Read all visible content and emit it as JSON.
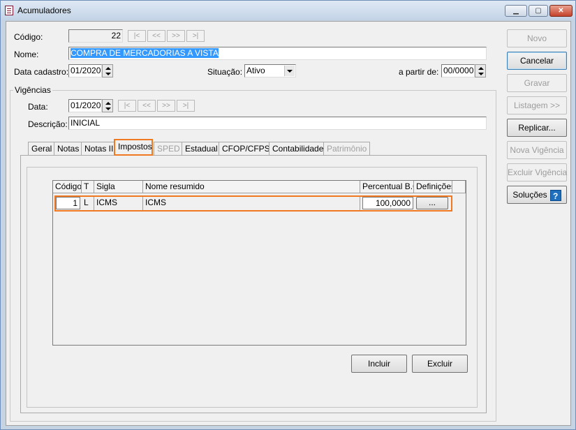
{
  "window": {
    "title": "Acumuladores",
    "minimize": "▁",
    "maximize": "▢",
    "close": "✕"
  },
  "form": {
    "codigo_label": "Código:",
    "codigo_value": "22",
    "nav": {
      "first": "|<",
      "prev": "<<",
      "next": ">>",
      "last": ">|"
    },
    "nome_label": "Nome:",
    "nome_value": "COMPRA DE MERCADORIAS A VISTA",
    "data_cadastro_label": "Data cadastro:",
    "data_cadastro_value": "01/2020",
    "situacao_label": "Situação:",
    "situacao_value": "Ativo",
    "a_partir_label": "a partir de:",
    "a_partir_value": "00/0000"
  },
  "vigencias": {
    "title": "Vigências",
    "data_label": "Data:",
    "data_value": "01/2020",
    "descricao_label": "Descrição:",
    "descricao_value": "INICIAL"
  },
  "tabs": [
    {
      "label": "Geral",
      "state": "normal"
    },
    {
      "label": "Notas",
      "state": "normal"
    },
    {
      "label": "Notas II",
      "state": "normal"
    },
    {
      "label": "Impostos",
      "state": "active"
    },
    {
      "label": "SPED",
      "state": "disabled"
    },
    {
      "label": "Estadual",
      "state": "normal"
    },
    {
      "label": "CFOP/CFPS",
      "state": "normal"
    },
    {
      "label": "Contabilidade",
      "state": "normal"
    },
    {
      "label": "Patrimônio",
      "state": "disabled"
    }
  ],
  "grid": {
    "headers": {
      "codigo": "Código",
      "t": "T",
      "sigla": "Sigla",
      "nome": "Nome resumido",
      "percentual": "Percentual B.C.",
      "definicoes": "Definições"
    },
    "rows": [
      {
        "codigo": "1",
        "t": "L",
        "sigla": "ICMS",
        "nome": "ICMS",
        "percentual": "100,0000",
        "definicoes": "..."
      }
    ]
  },
  "panel_buttons": {
    "incluir": "Incluir",
    "excluir": "Excluir"
  },
  "side_buttons": {
    "novo": "Novo",
    "cancelar": "Cancelar",
    "gravar": "Gravar",
    "listagem": "Listagem >>",
    "replicar": "Replicar...",
    "nova_vigencia": "Nova Vigência",
    "excluir_vigencia": "Excluir Vigência",
    "solucoes": "Soluções",
    "help_glyph": "?"
  },
  "colors": {
    "accent_highlight": "#f07820",
    "selection": "#3399ff"
  }
}
